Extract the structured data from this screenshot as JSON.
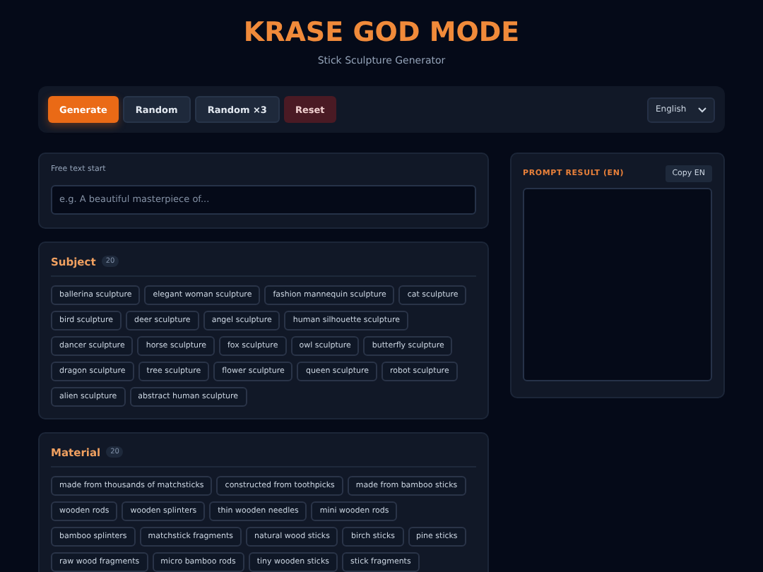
{
  "header": {
    "title": "KRASE GOD MODE",
    "subtitle": "Stick Sculpture Generator"
  },
  "toolbar": {
    "buttons": [
      {
        "label": "Generate",
        "kind": "primary"
      },
      {
        "label": "Random",
        "kind": "secondary"
      },
      {
        "label": "Random ×3",
        "kind": "secondary"
      },
      {
        "label": "Reset",
        "kind": "danger"
      }
    ],
    "language": "English"
  },
  "free_text": {
    "label": "Free text start",
    "placeholder": "e.g. A beautiful masterpiece of..."
  },
  "sections": [
    {
      "title": "Subject",
      "count": "20",
      "chips": [
        "ballerina sculpture",
        "elegant woman sculpture",
        "fashion mannequin sculpture",
        "cat sculpture",
        "bird sculpture",
        "deer sculpture",
        "angel sculpture",
        "human silhouette sculpture",
        "dancer sculpture",
        "horse sculpture",
        "fox sculpture",
        "owl sculpture",
        "butterfly sculpture",
        "dragon sculpture",
        "tree sculpture",
        "flower sculpture",
        "queen sculpture",
        "robot sculpture",
        "alien sculpture",
        "abstract human sculpture"
      ]
    },
    {
      "title": "Material",
      "count": "20",
      "chips": [
        "made from thousands of matchsticks",
        "constructed from toothpicks",
        "made from bamboo sticks",
        "wooden rods",
        "wooden splinters",
        "thin wooden needles",
        "mini wooden rods",
        "bamboo splinters",
        "matchstick fragments",
        "natural wood sticks",
        "birch sticks",
        "pine sticks",
        "raw wood fragments",
        "micro bamboo rods",
        "tiny wooden sticks",
        "stick fragments"
      ]
    }
  ],
  "result": {
    "title": "PROMPT RESULT (EN)",
    "copy_button": "Copy EN"
  }
}
